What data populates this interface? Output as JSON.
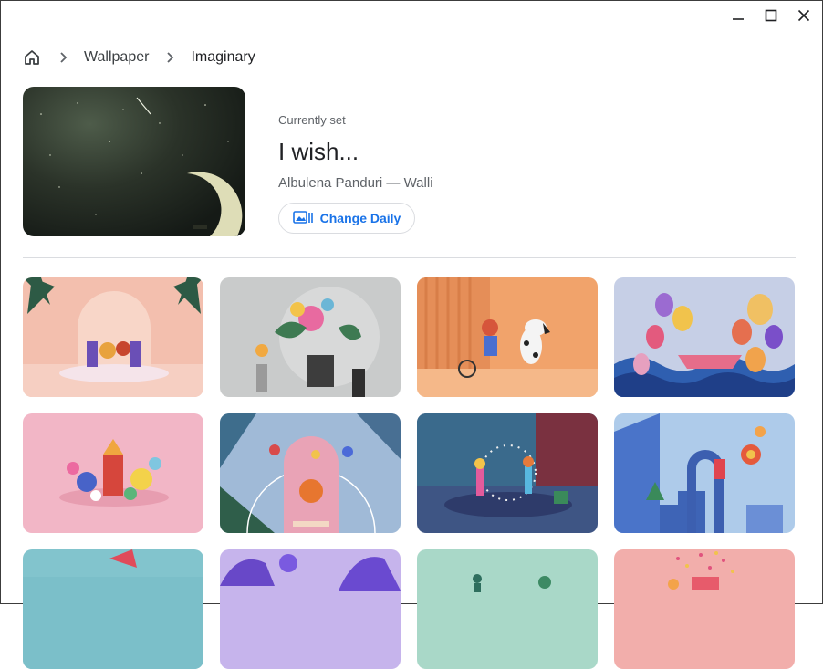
{
  "window": {
    "controls": [
      "minimize-icon",
      "maximize-icon",
      "close-icon"
    ]
  },
  "breadcrumb": {
    "home_icon": "home-icon",
    "items": [
      {
        "label": "Wallpaper"
      },
      {
        "label": "Imaginary"
      }
    ]
  },
  "current": {
    "status_label": "Currently set",
    "title": "I wish...",
    "author": "Albulena Panduri — Walli"
  },
  "change_daily": {
    "label": "Change Daily",
    "icon": "image-change-icon",
    "accent_color": "#1a73e8"
  },
  "gallery": {
    "tiles": [
      {
        "theme": "band on stage",
        "bg": "#f2b9a8"
      },
      {
        "theme": "flower person",
        "bg": "#c9cbcb"
      },
      {
        "theme": "boy and dog",
        "bg": "#f0a773"
      },
      {
        "theme": "boat with balloons",
        "bg": "#b9c7e3"
      },
      {
        "theme": "fantasy castle",
        "bg": "#f1b6c6"
      },
      {
        "theme": "basketball court",
        "bg": "#9fb8d6"
      },
      {
        "theme": "dancing figures",
        "bg": "#42567a"
      },
      {
        "theme": "blue stairs",
        "bg": "#a9c4ea"
      },
      {
        "theme": "teal scene",
        "bg": "#7ec4cf"
      },
      {
        "theme": "purple scene",
        "bg": "#b9a9e8"
      },
      {
        "theme": "mint scene",
        "bg": "#a5d6c6"
      },
      {
        "theme": "pink party scene",
        "bg": "#f0aaa8"
      }
    ]
  }
}
